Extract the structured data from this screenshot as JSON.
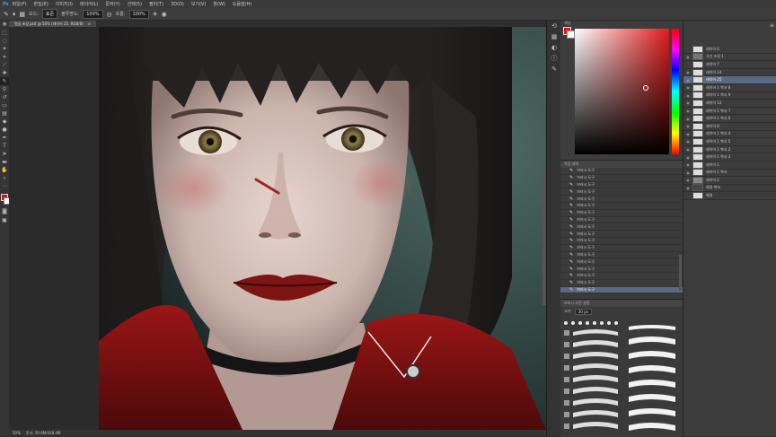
{
  "menubar": {
    "app_icon": "Ps",
    "items": [
      "파일(F)",
      "편집(E)",
      "이미지(I)",
      "레이어(L)",
      "문자(Y)",
      "선택(S)",
      "필터(T)",
      "3D(D)",
      "보기(V)",
      "창(W)",
      "도움말(H)"
    ]
  },
  "options": {
    "mode_label": "모드:",
    "mode_value": "표준",
    "opacity_label": "불투명도:",
    "opacity_value": "100%",
    "flow_label": "흐름:",
    "flow_value": "100%"
  },
  "document": {
    "tab_title": "얼굴 초상.psd @ 50% (레이어 25, RGB/8)",
    "zoom": "50%",
    "doc_info": "문서: 20.6M/418.4M"
  },
  "history": {
    "title": "작업 내역",
    "items": [
      "브러시 도구",
      "브러시 도구",
      "브러시 도구",
      "브러시 도구",
      "브러시 도구",
      "브러시 도구",
      "브러시 도구",
      "브러시 도구",
      "브러시 도구",
      "브러시 도구",
      "브러시 도구",
      "브러시 도구",
      "브러시 도구",
      "브러시 도구",
      "브러시 도구",
      "브러시 도구",
      "브러시 도구",
      "브러시 도구"
    ],
    "selected_index": 17
  },
  "brushes": {
    "title": "브러시 사전 설정",
    "size_label": "크기:",
    "size_value": "30 px"
  },
  "color_panel": {
    "title": "색상",
    "accent": "#e11b1b"
  },
  "layers": {
    "items": [
      {
        "name": "레이어 6"
      },
      {
        "name": "곡선 조정 1"
      },
      {
        "name": "레이어 7"
      },
      {
        "name": "레이어 14"
      },
      {
        "name": "레이어 25",
        "selected": true
      },
      {
        "name": "레이어 1 복사 8"
      },
      {
        "name": "레이어 1 복사 9"
      },
      {
        "name": "레이어 12"
      },
      {
        "name": "레이어 1 복사 7"
      },
      {
        "name": "레이어 1 복사 6"
      },
      {
        "name": "레이어 8"
      },
      {
        "name": "레이어 1 복사 4"
      },
      {
        "name": "레이어 1 복사 5"
      },
      {
        "name": "레이어 1 복사 2"
      },
      {
        "name": "레이어 1 복사 3"
      },
      {
        "name": "레이어 1"
      },
      {
        "name": "레이어 1 복사"
      },
      {
        "name": "레이어 2"
      },
      {
        "name": "배경 복사"
      },
      {
        "name": "배경"
      }
    ]
  }
}
